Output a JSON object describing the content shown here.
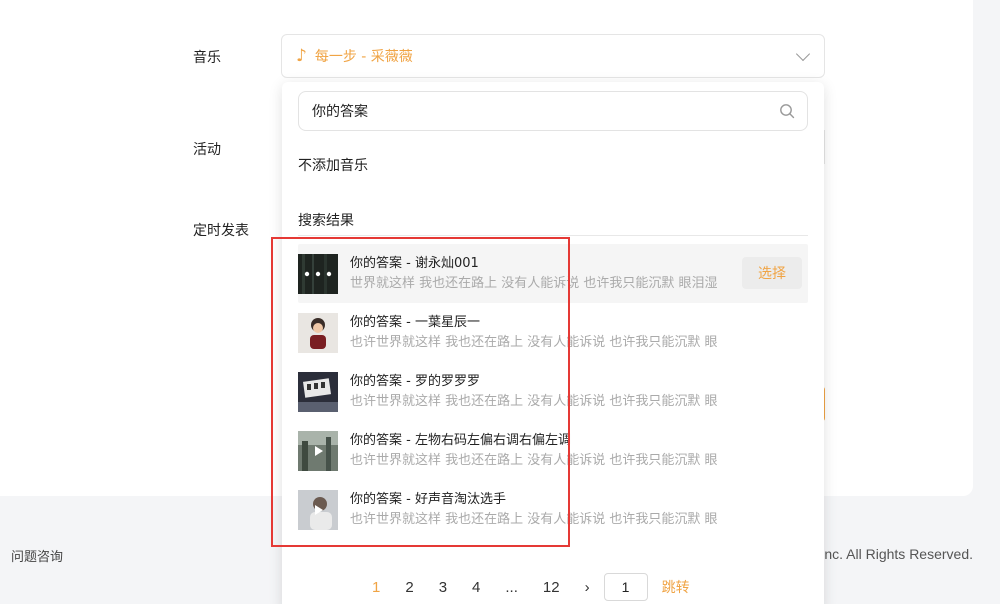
{
  "form": {
    "music_label": "音乐",
    "activity_label": "活动",
    "schedule_label": "定时发表",
    "selected_music": "每一步 - 采薇薇"
  },
  "dropdown": {
    "search_value": "你的答案",
    "no_music": "不添加音乐",
    "results_title": "搜索结果",
    "select_label": "选择",
    "results": [
      {
        "title": "你的答案 - 谢永灿001",
        "lyric": "世界就这样 我也还在路上 没有人能诉说 也许我只能沉默 眼泪湿"
      },
      {
        "title": "你的答案 - 一葉星辰一",
        "lyric": "也许世界就这样 我也还在路上 没有人能诉说 也许我只能沉默 眼"
      },
      {
        "title": "你的答案 - 罗的罗罗罗",
        "lyric": "也许世界就这样 我也还在路上 没有人能诉说 也许我只能沉默 眼"
      },
      {
        "title": "你的答案 - 左物右码左偏右调右偏左调",
        "lyric": "也许世界就这样 我也还在路上 没有人能诉说 也许我只能沉默 眼"
      },
      {
        "title": "你的答案 - 好声音淘汰选手",
        "lyric": "也许世界就这样 我也还在路上 没有人能诉说 也许我只能沉默 眼"
      }
    ]
  },
  "pagination": {
    "pages": [
      "1",
      "2",
      "3",
      "4"
    ],
    "ellipsis": "...",
    "last": "12",
    "next": "›",
    "input_value": "1",
    "jump": "跳转"
  },
  "footer": {
    "left": "问题咨询",
    "right": "nc. All Rights Reserved."
  },
  "colors": {
    "accent": "#f0a445",
    "highlight": "#e53935"
  }
}
